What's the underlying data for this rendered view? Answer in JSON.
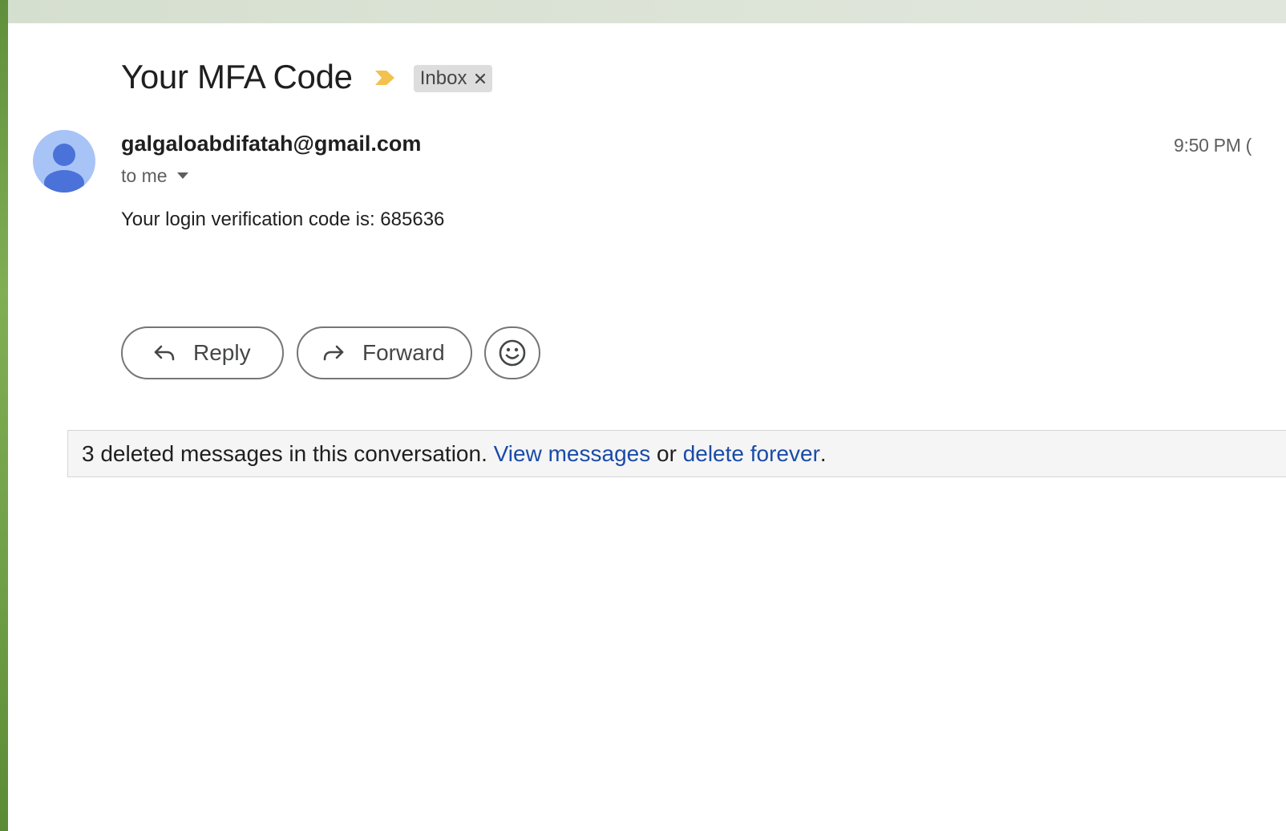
{
  "email": {
    "subject": "Your MFA Code",
    "label": "Inbox",
    "sender": "galgaloabdifatah@gmail.com",
    "recipients": "to me",
    "timestamp": "9:50 PM (",
    "body": "Your login verification code is: 685636"
  },
  "actions": {
    "reply_label": "Reply",
    "forward_label": "Forward"
  },
  "deleted_notice": {
    "text": "3 deleted messages in this conversation.",
    "view_link": "View messages",
    "connector": "or",
    "delete_link": "delete forever",
    "end": "."
  },
  "icons": {
    "importance": "importance-marker-icon",
    "label_remove": "close-icon",
    "recipients_toggle": "caret-down-icon",
    "avatar": "default-avatar-icon",
    "reply": "reply-arrow-icon",
    "forward": "forward-arrow-icon",
    "emoji": "smiley-icon"
  },
  "colors": {
    "importance": "#f2c14e",
    "link": "#1a4ba8",
    "avatar_bg": "#a8c4f7",
    "avatar_fg": "#4a72d9"
  }
}
